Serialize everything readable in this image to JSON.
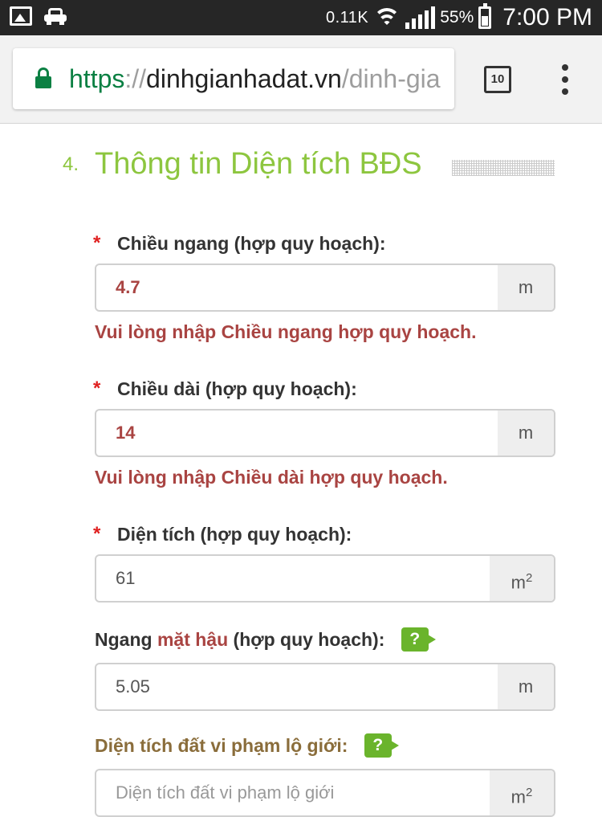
{
  "status_bar": {
    "net_speed": "0.11K",
    "battery": "55%",
    "time": "7:00 PM",
    "icons": [
      "photo-icon",
      "car-icon",
      "wifi-icon",
      "signal-icon",
      "battery-icon"
    ]
  },
  "browser": {
    "url_scheme": "https",
    "url_separator": "://",
    "url_host": "dinhgianhadat.vn",
    "url_path": "/dinh-gia",
    "tab_count": "10"
  },
  "section": {
    "number": "4.",
    "title": "Thông tin Diện tích BĐS"
  },
  "fields": {
    "width": {
      "label": "Chiều ngang (hợp quy hoạch):",
      "value": "4.7",
      "unit": "m",
      "error": "Vui lòng nhập Chiều ngang hợp quy hoạch."
    },
    "length": {
      "label": "Chiều dài (hợp quy hoạch):",
      "value": "14",
      "unit": "m",
      "error": "Vui lòng nhập Chiều dài hợp quy hoạch."
    },
    "area": {
      "label": "Diện tích (hợp quy hoạch):",
      "value": "61",
      "unit": "m",
      "unit_sup": "2"
    },
    "back_width": {
      "label_prefix": "Ngang ",
      "label_emph": "mặt hậu",
      "label_suffix": " (hợp quy hoạch):",
      "value": "5.05",
      "unit": "m",
      "help": "?"
    },
    "violation_area": {
      "label": "Diện tích đất vi phạm lộ giới:",
      "placeholder": "Diện tích đất vi phạm lộ giới",
      "unit": "m",
      "unit_sup": "2",
      "help": "?"
    }
  },
  "required_marker": "*",
  "colors": {
    "heading_green": "#8dc63f",
    "error_red": "#a94442",
    "required_red": "#e02020",
    "help_green": "#6ab42c",
    "secure_green": "#0b8043"
  }
}
